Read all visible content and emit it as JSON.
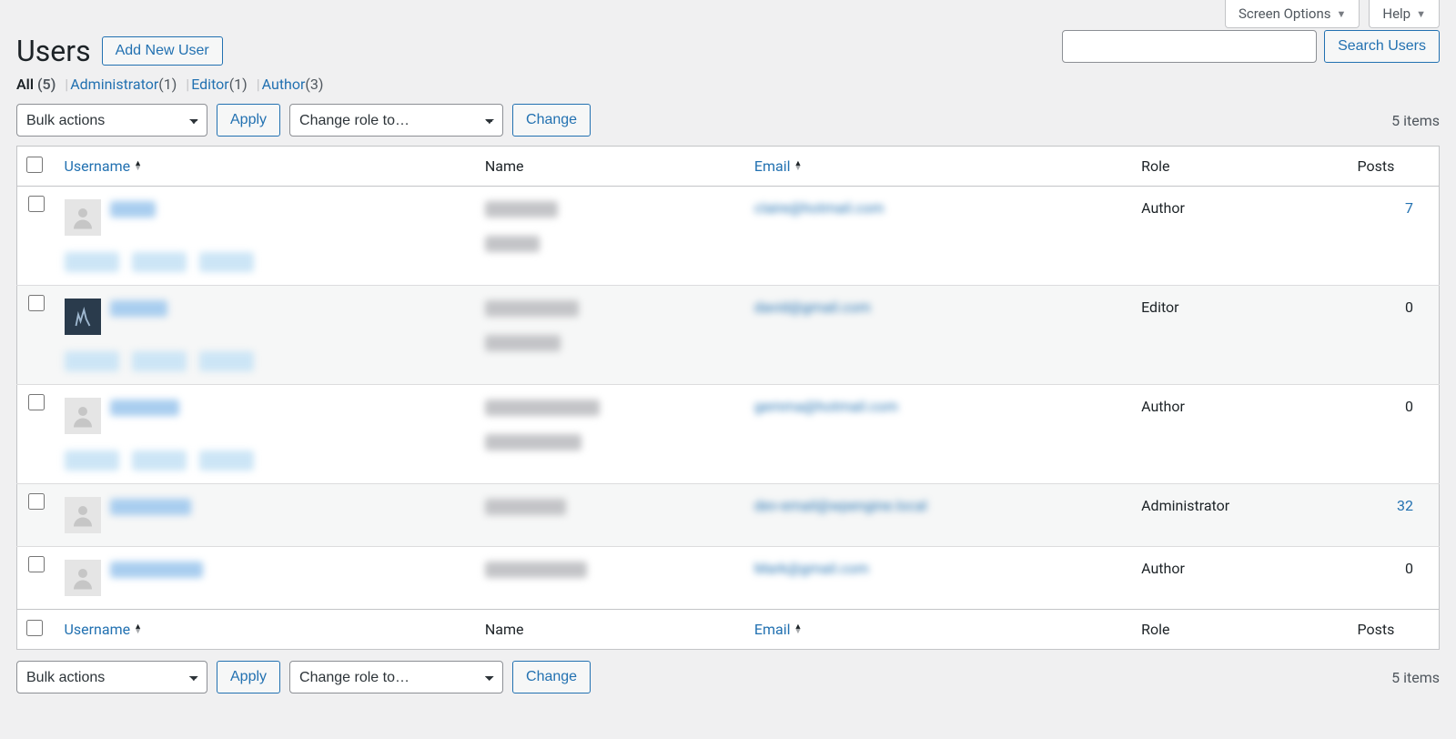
{
  "topTabs": {
    "screenOptions": "Screen Options",
    "help": "Help"
  },
  "page": {
    "title": "Users",
    "addNew": "Add New User",
    "searchUsers": "Search Users"
  },
  "filters": {
    "all": {
      "label": "All",
      "count": "(5)"
    },
    "administrator": {
      "label": "Administrator",
      "count": "(1)"
    },
    "editor": {
      "label": "Editor",
      "count": "(1)"
    },
    "author": {
      "label": "Author",
      "count": "(3)"
    }
  },
  "bulk": {
    "bulkActions": "Bulk actions",
    "apply": "Apply",
    "changeRoleTo": "Change role to…",
    "change": "Change"
  },
  "itemsText": "5 items",
  "columns": {
    "username": "Username",
    "name": "Name",
    "email": "Email",
    "role": "Role",
    "posts": "Posts"
  },
  "rows": [
    {
      "email": "claire@hotmail.com",
      "role": "Author",
      "posts": "7",
      "hasActions": true,
      "avatar": "default"
    },
    {
      "email": "david@gmail.com",
      "role": "Editor",
      "posts": "0",
      "hasActions": true,
      "avatar": "dark"
    },
    {
      "email": "gemma@hotmail.com",
      "role": "Author",
      "posts": "0",
      "hasActions": true,
      "avatar": "default"
    },
    {
      "email": "dev-email@wpengine.local",
      "role": "Administrator",
      "posts": "32",
      "hasActions": false,
      "avatar": "default"
    },
    {
      "email": "Mark@gmail.com",
      "role": "Author",
      "posts": "0",
      "hasActions": false,
      "avatar": "default"
    }
  ]
}
